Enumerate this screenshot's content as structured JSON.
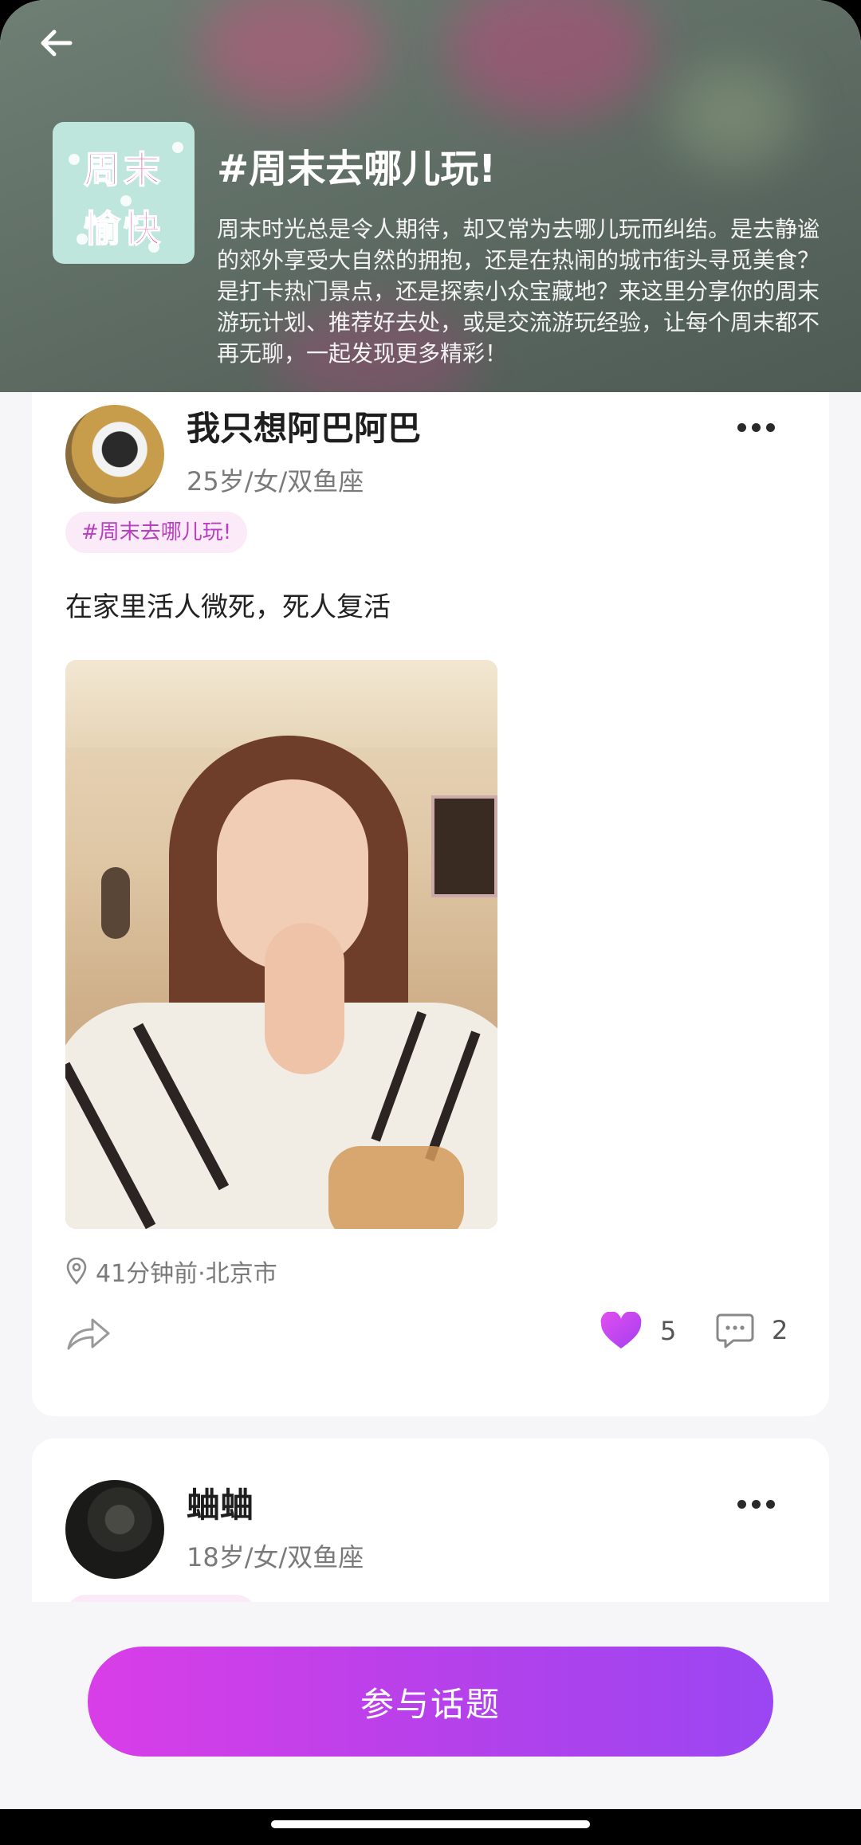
{
  "header": {
    "cover_lines": [
      "周末",
      "愉快"
    ],
    "title": "#周末去哪儿玩!",
    "description": "周末时光总是令人期待，却又常为去哪儿玩而纠结。是去静谧的郊外享受大自然的拥抱，还是在热闹的城市街头寻觅美食？是打卡热门景点，还是探索小众宝藏地？来这里分享你的周末游玩计划、推荐好去处，或是交流游玩经验，让每个周末都不再无聊，一起发现更多精彩！"
  },
  "posts": [
    {
      "username": "我只想阿巴阿巴",
      "meta": "25岁/女/双鱼座",
      "tag": "#周末去哪儿玩!",
      "text": "在家里活人微死，死人复活",
      "location": "41分钟前·北京市",
      "likes": "5",
      "comments": "2"
    },
    {
      "username": "蛐蛐",
      "meta": "18岁/女/双鱼座"
    }
  ],
  "cta_label": "参与话题",
  "colors": {
    "accent": "#b441ea",
    "like": "#c13bef"
  },
  "icons": [
    "back-arrow-icon",
    "more-dots-icon",
    "location-pin-icon",
    "share-icon",
    "heart-icon",
    "comment-icon"
  ]
}
